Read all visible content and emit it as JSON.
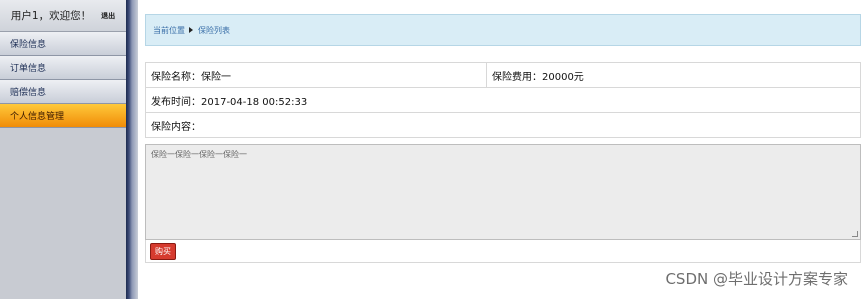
{
  "sidebar": {
    "greeting": "用户1，欢迎您！",
    "logout_label": "退出",
    "items": [
      {
        "label": "保险信息"
      },
      {
        "label": "订单信息"
      },
      {
        "label": "赔偿信息"
      },
      {
        "label": "个人信息管理"
      }
    ],
    "active_index": 3
  },
  "breadcrumb": {
    "current_location": "当前位置",
    "page": "保险列表"
  },
  "details": {
    "name": "保险名称：保险一",
    "fee": "保险费用：20000元",
    "published": "发布时间：2017-04-18 00:52:33",
    "content_label": "保险内容："
  },
  "content_text": "保险一保险一保险一保险一",
  "buy_label": "购买",
  "watermark": "CSDN @毕业设计方案专家",
  "colors": {
    "active_menu": "#f5a623",
    "breadcrumb_bg": "#d9edf6",
    "buy_button": "#d63b2f"
  }
}
